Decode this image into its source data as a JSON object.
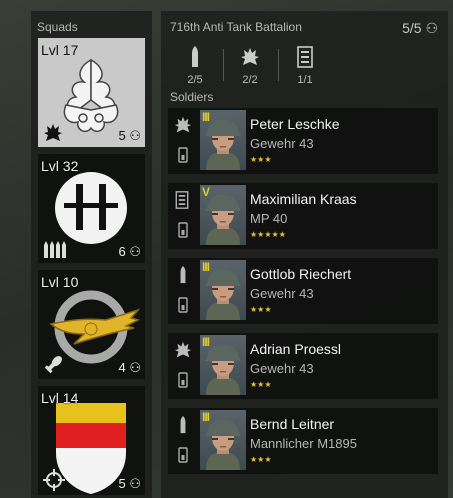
{
  "squads": {
    "title": "Squads",
    "items": [
      {
        "level": "Lvl 17",
        "count": "5",
        "emblem": "oak-leaves-emblem",
        "type_icon": "flame-icon",
        "selected": true
      },
      {
        "level": "Lvl 32",
        "count": "6",
        "emblem": "h-emblem",
        "type_icon": "ammo-belt-icon",
        "selected": false
      },
      {
        "level": "Lvl 10",
        "count": "4",
        "emblem": "eagle-wreath-emblem",
        "type_icon": "mortar-shell-icon",
        "selected": false
      },
      {
        "level": "Lvl 14",
        "count": "5",
        "emblem": "striped-shield-emblem",
        "type_icon": "crosshair-icon",
        "selected": false
      }
    ]
  },
  "battalion": {
    "name": "716th Anti Tank Battalion",
    "count": "5/5",
    "stats": [
      {
        "icon": "bullet-icon",
        "value": "2/5"
      },
      {
        "icon": "flame-icon",
        "value": "2/2"
      },
      {
        "icon": "list-icon",
        "value": "1/1"
      }
    ]
  },
  "soldiers": {
    "title": "Soldiers",
    "items": [
      {
        "name": "Peter Leschke",
        "weapon": "Gewehr 43",
        "rank": "III",
        "stars": "★★★",
        "role_icon": "flame-icon"
      },
      {
        "name": "Maximilian Kraas",
        "weapon": "MP 40",
        "rank": "V",
        "stars": "★★★★★",
        "role_icon": "list-icon"
      },
      {
        "name": "Gottlob Riechert",
        "weapon": "Gewehr 43",
        "rank": "III",
        "stars": "★★★",
        "role_icon": "bullet-icon"
      },
      {
        "name": "Adrian Proessl",
        "weapon": "Gewehr 43",
        "rank": "III",
        "stars": "★★★",
        "role_icon": "flame-icon"
      },
      {
        "name": "Bernd Leitner",
        "weapon": "Mannlicher M1895",
        "rank": "III",
        "stars": "★★★",
        "role_icon": "bullet-icon"
      }
    ]
  },
  "colors": {
    "accent": "#e2c829",
    "panel": "#1c1e1c",
    "selected": "#c9c9c9"
  }
}
